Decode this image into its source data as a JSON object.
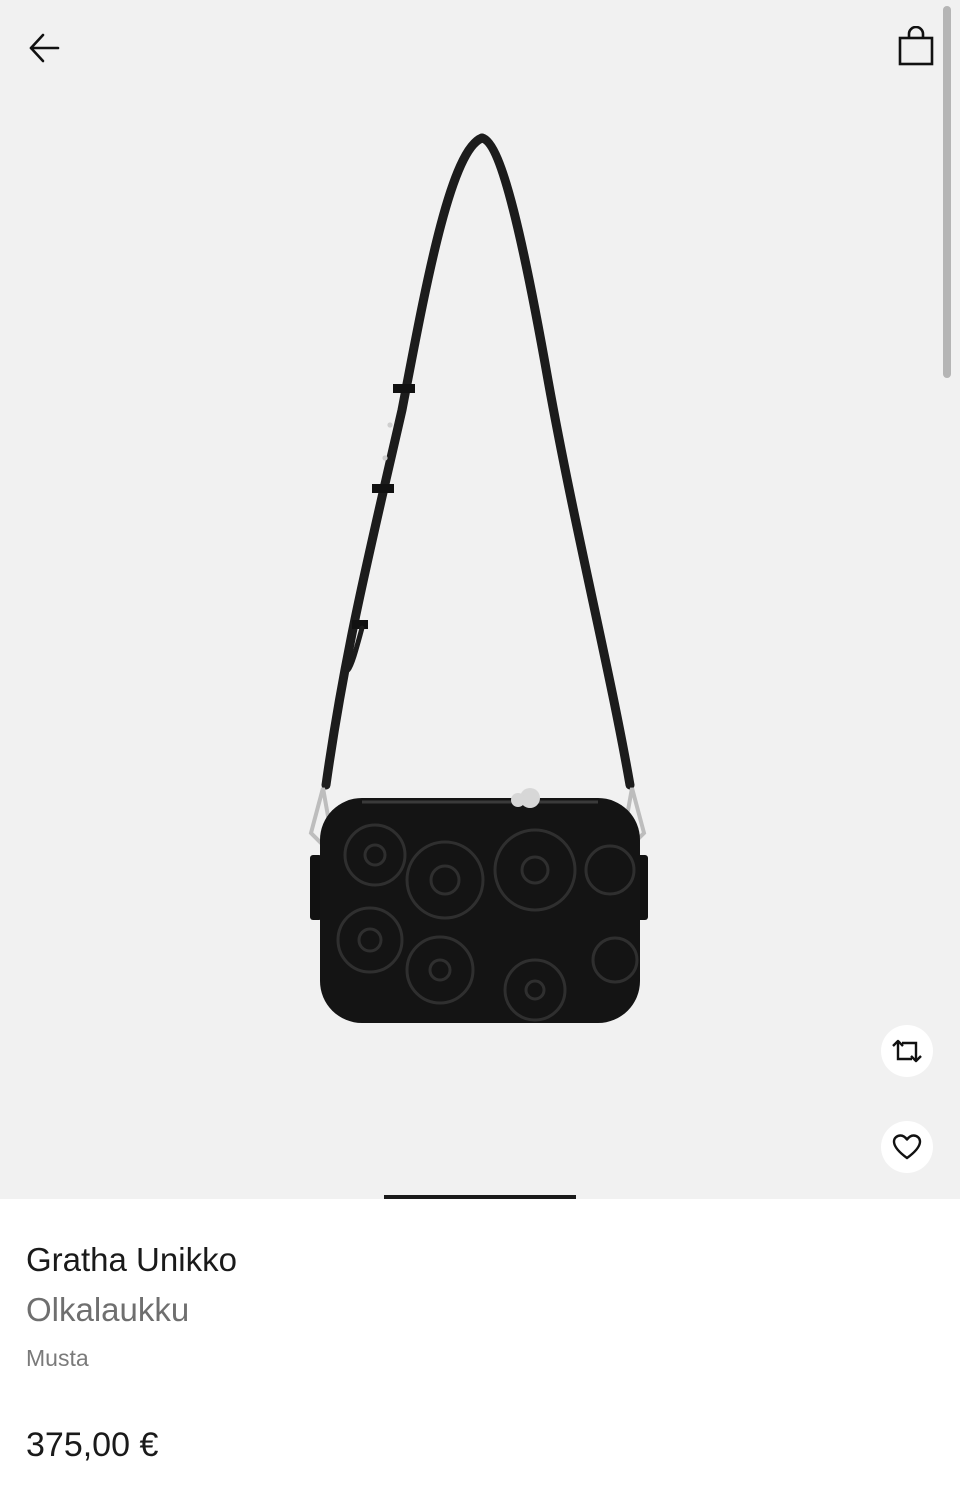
{
  "header": {
    "back_icon": "arrow-left-icon",
    "cart_icon": "shopping-bag-icon"
  },
  "gallery": {
    "image": "black quilted crossbody shoulder bag",
    "swap_icon": "rotate-arrows-icon",
    "favorite_icon": "heart-icon",
    "current_slide_indicator_color": "#1a1a1a"
  },
  "product": {
    "name": "Gratha Unikko",
    "type": "Olkalaukku",
    "color": "Musta",
    "price": "375,00 €"
  },
  "colors": {
    "hero_background": "#f1f1f1",
    "text_primary": "#1a1a1a",
    "text_secondary": "#6f6f6f"
  }
}
